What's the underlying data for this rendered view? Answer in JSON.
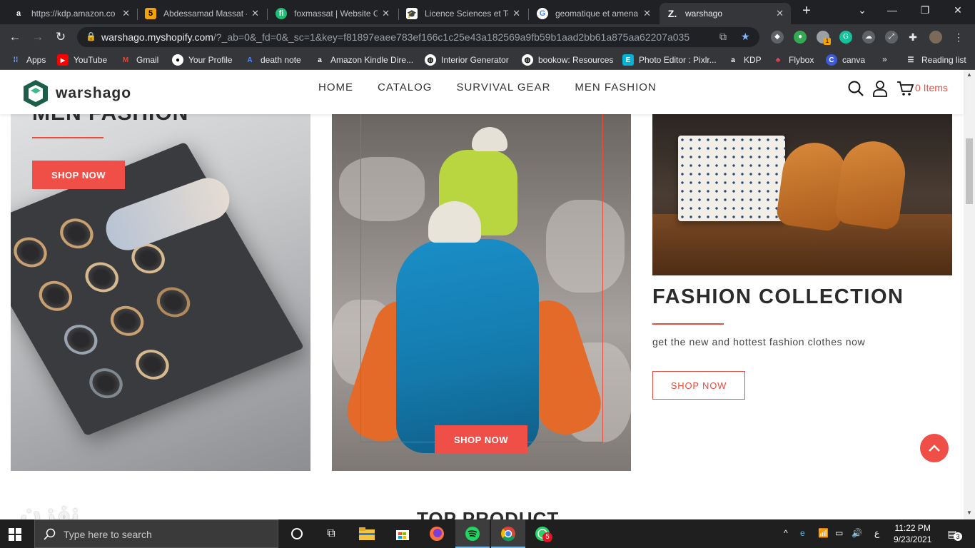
{
  "browser": {
    "tabs": [
      {
        "title": "https://kdp.amazon.co",
        "icon": "amazon-icon"
      },
      {
        "title": "Abdessamad Massat -",
        "icon": "bookmark-5-icon"
      },
      {
        "title": "foxmassat | Website C",
        "icon": "fiverr-icon"
      },
      {
        "title": "Licence Sciences et Te",
        "icon": "graduation-icon"
      },
      {
        "title": "geomatique et amena",
        "icon": "google-icon"
      },
      {
        "title": "warshago",
        "icon": "z-icon"
      }
    ],
    "url_host": "warshago.myshopify.com",
    "url_rest": "/?_ab=0&_fd=0&_sc=1&key=f81897eaee783ef166c1c25e43a182569a9fb59b1aad2bb61a875aa62207a035",
    "bookmarks": [
      "Apps",
      "YouTube",
      "Gmail",
      "Your Profile",
      "death note",
      "Amazon Kindle Dire...",
      "Interior Generator",
      "bookow: Resources",
      "Photo Editor : Pixlr...",
      "KDP",
      "Flybox",
      "canva"
    ],
    "bookmarks_overflow": "»",
    "reading_list": "Reading list",
    "extension_badge": "1"
  },
  "site": {
    "logo_text": "warshago",
    "nav": [
      "HOME",
      "CATALOG",
      "SURVIVAL GEAR",
      "MEN FASHION"
    ],
    "cart_label": "0 Items",
    "accent_color": "#e84c3d",
    "panels": {
      "left": {
        "title": "MEN FASHION",
        "button": "SHOP NOW"
      },
      "middle": {
        "button": "SHOP NOW"
      },
      "right": {
        "title": "FASHION COLLECTION",
        "description": "get the new and hottest fashion clothes now",
        "button": "SHOP NOW"
      }
    },
    "next_section_title": "TOP PRODUCT"
  },
  "watermark": "نفزن",
  "taskbar": {
    "search_placeholder": "Type here to search",
    "whatsapp_badge": "5",
    "tray_lang": "ع",
    "time": "11:22 PM",
    "date": "9/23/2021",
    "notifications": "3"
  }
}
